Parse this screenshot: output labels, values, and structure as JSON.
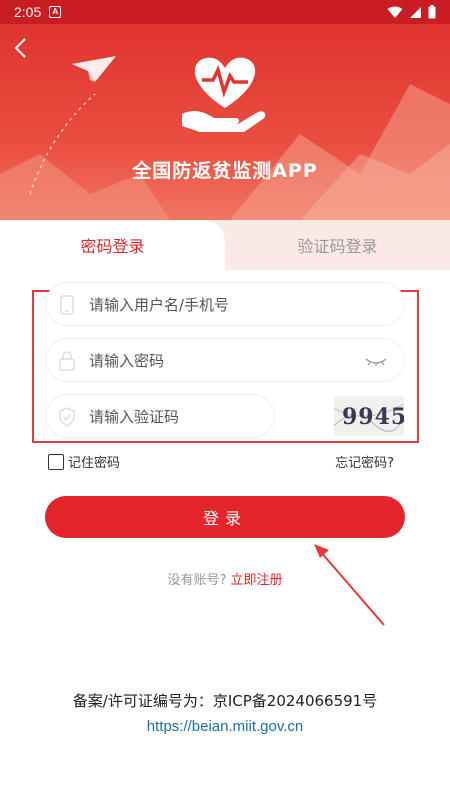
{
  "status_bar": {
    "time": "2:05",
    "notification_icon": "A"
  },
  "header": {
    "title": "全国防返贫监测APP"
  },
  "tabs": [
    {
      "label": "密码登录",
      "active": true
    },
    {
      "label": "验证码登录",
      "active": false
    }
  ],
  "form": {
    "username_placeholder": "请输入用户名/手机号",
    "password_placeholder": "请输入密码",
    "captcha_placeholder": "请输入验证码",
    "captcha_code": "9945",
    "remember_label": "记住密码",
    "forgot_label": "忘记密码?",
    "login_label": "登录"
  },
  "register": {
    "prompt": "没有账号?",
    "link": "立即注册"
  },
  "footer": {
    "icp": "备案/许可证编号为：京ICP备2024066591号",
    "url": "https://beian.miit.gov.cn"
  },
  "colors": {
    "brand_red": "#e4242b",
    "highlight_box": "#e33a3a",
    "link_blue": "#1f6fa8"
  }
}
